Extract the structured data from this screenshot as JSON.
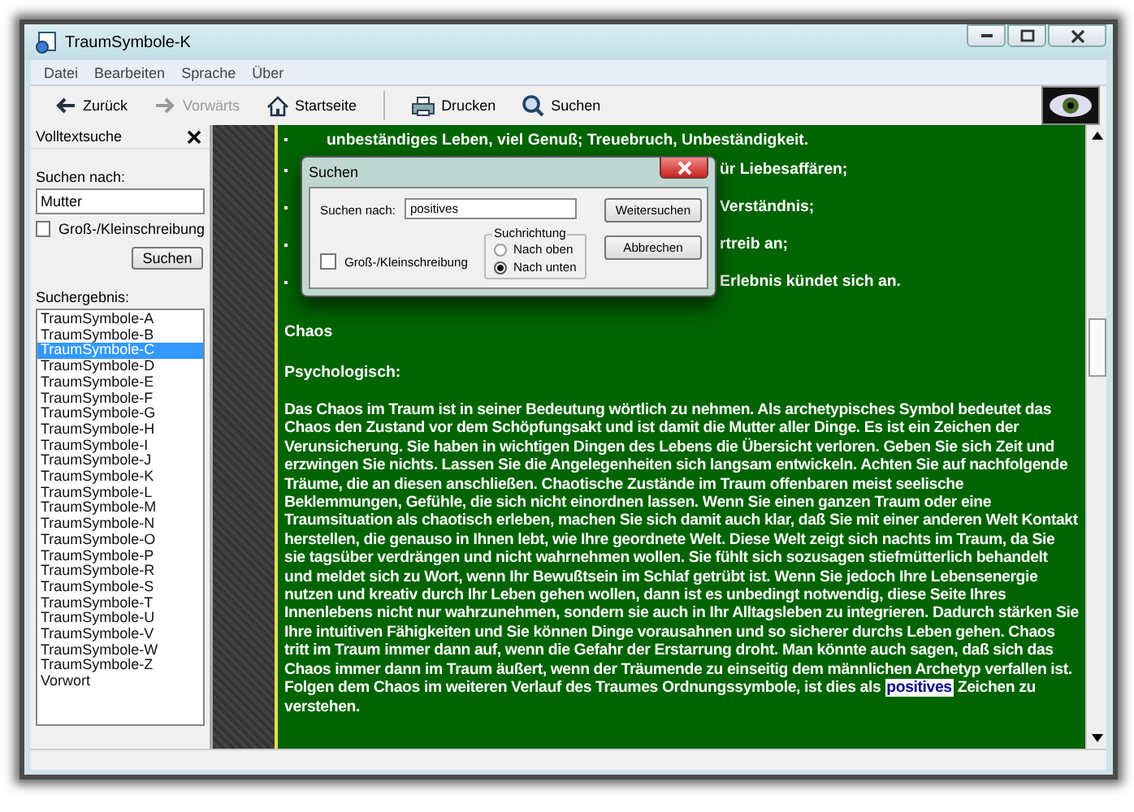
{
  "window": {
    "title": "TraumSymbole-K"
  },
  "menu": [
    "Datei",
    "Bearbeiten",
    "Sprache",
    "Über"
  ],
  "toolbar": [
    [
      {
        "kind": "back",
        "label": "Zurück",
        "disabled": false
      },
      {
        "kind": "forward",
        "label": "Vorwärts",
        "disabled": true
      },
      {
        "kind": "home",
        "label": "Startseite",
        "disabled": false
      }
    ],
    [
      {
        "kind": "print",
        "label": "Drucken",
        "disabled": false
      },
      {
        "kind": "search",
        "label": "Suchen",
        "disabled": false
      }
    ]
  ],
  "sidebar": {
    "title": "Volltextsuche",
    "search_label": "Suchen nach:",
    "search_value": "Mutter",
    "case_checkbox": {
      "label": "Groß-/Kleinschreibung",
      "checked": false
    },
    "search_button": "Suchen",
    "results_label": "Suchergebnis:",
    "results": [
      {
        "label": "TraumSymbole-A",
        "selected": false
      },
      {
        "label": "TraumSymbole-B",
        "selected": false
      },
      {
        "label": "TraumSymbole-C",
        "selected": true
      },
      {
        "label": "TraumSymbole-D",
        "selected": false
      },
      {
        "label": "TraumSymbole-E",
        "selected": false
      },
      {
        "label": "TraumSymbole-F",
        "selected": false
      },
      {
        "label": "TraumSymbole-G",
        "selected": false
      },
      {
        "label": "TraumSymbole-H",
        "selected": false
      },
      {
        "label": "TraumSymbole-I",
        "selected": false
      },
      {
        "label": "TraumSymbole-J",
        "selected": false
      },
      {
        "label": "TraumSymbole-K",
        "selected": false
      },
      {
        "label": "TraumSymbole-L",
        "selected": false
      },
      {
        "label": "TraumSymbole-M",
        "selected": false
      },
      {
        "label": "TraumSymbole-N",
        "selected": false
      },
      {
        "label": "TraumSymbole-O",
        "selected": false
      },
      {
        "label": "TraumSymbole-P",
        "selected": false
      },
      {
        "label": "TraumSymbole-R",
        "selected": false
      },
      {
        "label": "TraumSymbole-S",
        "selected": false
      },
      {
        "label": "TraumSymbole-T",
        "selected": false
      },
      {
        "label": "TraumSymbole-U",
        "selected": false
      },
      {
        "label": "TraumSymbole-V",
        "selected": false
      },
      {
        "label": "TraumSymbole-W",
        "selected": false
      },
      {
        "label": "TraumSymbole-Z",
        "selected": false
      },
      {
        "label": "Vorwort",
        "selected": false
      }
    ]
  },
  "content": {
    "bullets": [
      {
        "text": "unbeständiges Leben, viel Genuß; Treuebruch, Unbeständigkeit.",
        "covered": false
      },
      {
        "text": "ür Liebesaffären;",
        "covered": true
      },
      {
        "text": "Verständnis;",
        "covered": true
      },
      {
        "text": "rtreib an;",
        "covered": true
      },
      {
        "text": "Erlebnis kündet sich an.",
        "covered": true
      }
    ],
    "heading": "Chaos",
    "subheading": "Psychologisch:",
    "paragraph": {
      "before": "Das Chaos im Traum ist in seiner Bedeutung wörtlich zu nehmen. Als archetypisches Symbol bedeutet das Chaos den Zustand vor dem Schöpfungsakt und ist damit die Mutter aller Dinge. Es ist ein Zeichen der Verunsicherung. Sie haben in wichtigen Dingen des Lebens die Übersicht verloren. Geben Sie sich Zeit und erzwingen Sie nichts. Lassen Sie die Angelegenheiten sich langsam entwickeln. Achten Sie auf nachfolgende Träume, die an diesen anschließen. Chaotische Zustände im Traum offenbaren meist seelische Beklemmungen, Gefühle, die sich nicht einordnen lassen. Wenn Sie einen ganzen Traum oder eine Traumsituation als chaotisch erleben, machen Sie sich damit auch klar, daß Sie mit einer anderen Welt Kontakt herstellen, die genauso in Ihnen lebt, wie Ihre geordnete Welt. Diese Welt zeigt sich nachts im Traum, da Sie sie tagsüber verdrängen und nicht wahrnehmen wollen. Sie fühlt sich sozusagen stiefmütterlich behandelt und meldet sich zu Wort, wenn Ihr Bewußtsein im Schlaf getrübt ist. Wenn Sie jedoch Ihre Lebensenergie nutzen und kreativ durch Ihr Leben gehen wollen, dann ist es unbedingt notwendig, diese Seite Ihres Innenlebens nicht nur wahrzunehmen, sondern sie auch in Ihr Alltagsleben zu integrieren. Dadurch stärken Sie Ihre intuitiven Fähigkeiten und Sie können Dinge vorausahnen und so sicherer durchs Leben gehen. Chaos tritt im Traum immer dann auf, wenn die Gefahr der Erstarrung droht. Man könnte auch sagen, daß sich das Chaos immer dann im Traum äußert, wenn der Träumende zu einseitig dem männlichen Archetyp verfallen ist. Folgen dem Chaos im weiteren Verlauf des Traumes Ordnungssymbole, ist dies als ",
      "match": "positives",
      "after": " Zeichen zu verstehen."
    }
  },
  "dialog": {
    "title": "Suchen",
    "search_label": "Suchen nach:",
    "search_value": "positives",
    "buttons": [
      "Weitersuchen",
      "Abbrechen"
    ],
    "case_checkbox": {
      "label": "Groß-/Kleinschreibung",
      "checked": false
    },
    "direction_label": "Suchrichtung",
    "directions": [
      {
        "label": "Nach oben",
        "selected": false
      },
      {
        "label": "Nach unten",
        "selected": true
      }
    ]
  }
}
